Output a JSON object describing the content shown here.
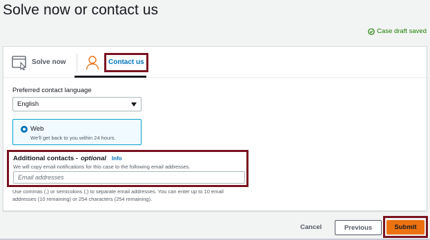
{
  "page": {
    "title": "Solve now or contact us",
    "draft_status": "Case draft saved"
  },
  "tabs": [
    {
      "label": "Solve now",
      "icon": "cursor-window-icon",
      "selected": false
    },
    {
      "label": "Contact us",
      "icon": "person-icon",
      "selected": true
    }
  ],
  "language": {
    "label": "Preferred contact language",
    "value": "English"
  },
  "contact_method": {
    "title": "Web",
    "description": "We'll get back to you within 24 hours.",
    "selected": true
  },
  "additional_contacts": {
    "label": "Additional contacts -",
    "optional": "optional",
    "info": "Info",
    "description": "We will copy email notifications for this case to the following email addresses.",
    "placeholder": "Email addresses",
    "help_text": "Use commas (,) or semicolons (;) to separate email addresses. You can enter up to 10 email addresses (10 remaining) or 254 characters (254 remaining)."
  },
  "actions": {
    "cancel": "Cancel",
    "previous": "Previous",
    "submit": "Submit"
  },
  "colors": {
    "accent_link": "#0073bb",
    "success": "#1d8102",
    "submit": "#ec7211",
    "highlight_frame": "#7a1220"
  }
}
